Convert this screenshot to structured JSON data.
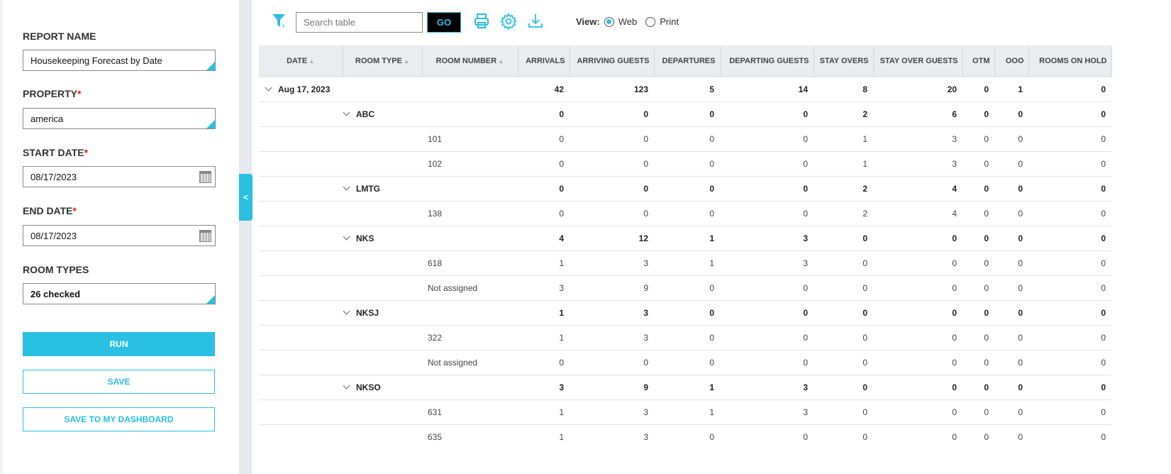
{
  "form": {
    "report_name_label": "REPORT NAME",
    "report_name": "Housekeeping Forecast by Date",
    "property_label": "PROPERTY",
    "property": "america",
    "start_label": "START DATE",
    "start_date": "08/17/2023",
    "end_label": "END DATE",
    "end_date": "08/17/2023",
    "room_types_label": "ROOM TYPES",
    "room_types": "26 checked",
    "required_mark": "*",
    "run": "RUN",
    "save": "SAVE",
    "save_dash": "SAVE TO MY DASHBOARD"
  },
  "collapse_label": "<",
  "toolbar": {
    "search_placeholder": "Search table",
    "go": "GO",
    "view_label": "View:",
    "web": "Web",
    "print": "Print",
    "view_selected": "Web"
  },
  "accent": "#29c0e4",
  "table": {
    "columns": [
      "DATE",
      "ROOM TYPE",
      "ROOM NUMBER",
      "ARRIVALS",
      "ARRIVING GUESTS",
      "DEPARTURES",
      "DEPARTING GUESTS",
      "STAY OVERS",
      "STAY OVER GUESTS",
      "OTM",
      "OOO",
      "ROOMS ON HOLD"
    ],
    "sortable": [
      true,
      true,
      true,
      false,
      false,
      false,
      false,
      false,
      false,
      false,
      false,
      false
    ],
    "rows": [
      {
        "level": 0,
        "label": "Aug 17, 2023",
        "v": [
          42,
          123,
          5,
          14,
          8,
          20,
          0,
          1,
          0
        ]
      },
      {
        "level": 1,
        "label": "ABC",
        "v": [
          0,
          0,
          0,
          0,
          2,
          6,
          0,
          0,
          0
        ]
      },
      {
        "level": 2,
        "label": "101",
        "v": [
          0,
          0,
          0,
          0,
          1,
          3,
          0,
          0,
          0
        ]
      },
      {
        "level": 2,
        "label": "102",
        "v": [
          0,
          0,
          0,
          0,
          1,
          3,
          0,
          0,
          0
        ]
      },
      {
        "level": 1,
        "label": "LMTG",
        "v": [
          0,
          0,
          0,
          0,
          2,
          4,
          0,
          0,
          0
        ]
      },
      {
        "level": 2,
        "label": "138",
        "v": [
          0,
          0,
          0,
          0,
          2,
          4,
          0,
          0,
          0
        ]
      },
      {
        "level": 1,
        "label": "NKS",
        "v": [
          4,
          12,
          1,
          3,
          0,
          0,
          0,
          0,
          0
        ]
      },
      {
        "level": 2,
        "label": "618",
        "v": [
          1,
          3,
          1,
          3,
          0,
          0,
          0,
          0,
          0
        ]
      },
      {
        "level": 2,
        "label": "Not assigned",
        "v": [
          3,
          9,
          0,
          0,
          0,
          0,
          0,
          0,
          0
        ]
      },
      {
        "level": 1,
        "label": "NKSJ",
        "v": [
          1,
          3,
          0,
          0,
          0,
          0,
          0,
          0,
          0
        ]
      },
      {
        "level": 2,
        "label": "322",
        "v": [
          1,
          3,
          0,
          0,
          0,
          0,
          0,
          0,
          0
        ]
      },
      {
        "level": 2,
        "label": "Not assigned",
        "v": [
          0,
          0,
          0,
          0,
          0,
          0,
          0,
          0,
          0
        ]
      },
      {
        "level": 1,
        "label": "NKSO",
        "v": [
          3,
          9,
          1,
          3,
          0,
          0,
          0,
          0,
          0
        ]
      },
      {
        "level": 2,
        "label": "631",
        "v": [
          1,
          3,
          1,
          3,
          0,
          0,
          0,
          0,
          0
        ]
      },
      {
        "level": 2,
        "label": "635",
        "v": [
          1,
          3,
          0,
          0,
          0,
          0,
          0,
          0,
          0
        ]
      }
    ]
  }
}
